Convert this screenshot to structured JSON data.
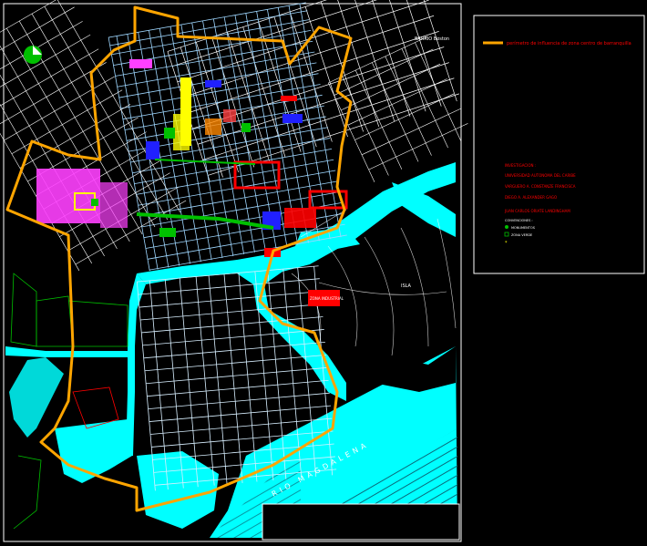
{
  "colors": {
    "background": "#000000",
    "sea": "#00ffff",
    "boundary": "#ffa500",
    "streets": "#ffffff",
    "streets_light": "#9fd7ff",
    "highlight_red": "#ff0000",
    "magenta": "#ff40ff",
    "yellow": "#ffff00",
    "green": "#00c000",
    "blue": "#2020ff"
  },
  "legend": {
    "boundary_label": "perímetro de influencia de zona centro de barranquilla",
    "credits": [
      "INVESTIGACION :",
      "UNIVERSIDAD AUTONOMA DEL CARIBE",
      "VARGUERO A. CONSTANZE FRANCISCA",
      "DIEGO A. ALEXANDER GAGO",
      "JUAN CARLOS ORIATE LANDINGHAM"
    ],
    "symbols": [
      {
        "label": "CONVENCIONES :"
      },
      {
        "label": "MONUMENTOS",
        "icon": "green-dot-icon"
      },
      {
        "label": "ZONA VERDE",
        "icon": "green-square-icon"
      },
      {
        "label": "",
        "icon": "yellow-star-icon"
      }
    ]
  },
  "map_labels": {
    "river": "RIO MAGDALENA",
    "north_tag": "BARRIO Boston",
    "isla": "ISLA",
    "red_block": "ZONA INDUSTRIAL"
  },
  "icons": {
    "north_arrow": "north-arrow-icon"
  }
}
